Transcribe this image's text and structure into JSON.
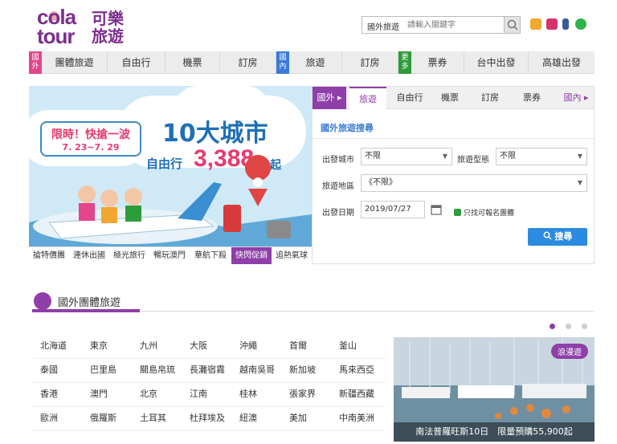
{
  "logo": {
    "en1": "cola",
    "en2": "tour",
    "cn1": "可樂",
    "cn2": "旅遊"
  },
  "search": {
    "category": "國外旅遊",
    "placeholder": "請輸入關鍵字"
  },
  "nav": {
    "groups": [
      {
        "tag": "國外"
      },
      {
        "tag": "國內"
      },
      {
        "tag": "更多"
      }
    ],
    "items": [
      "團體旅遊",
      "自由行",
      "機票",
      "訂房",
      "旅遊",
      "訂房",
      "票券",
      "台中出發",
      "高雄出發"
    ]
  },
  "banner": {
    "promo1": "限時！快搶一波",
    "promo2": "7. 23~7. 29",
    "headline": "10大城市",
    "sub1": "自由行",
    "price": "3,388",
    "sub2": "起",
    "tabs": [
      "搶特價團",
      "連休出國",
      "極光旅行",
      "暢玩澳門",
      "華航下殺",
      "快閃促銷",
      "追熱氣球"
    ]
  },
  "panel": {
    "tabs": [
      "國外",
      "旅遊",
      "自由行",
      "機票",
      "訂房",
      "票券",
      "國內"
    ],
    "title": "國外旅遊搜尋",
    "depart_label": "出發城市",
    "depart_value": "不限",
    "type_label": "旅遊型態",
    "type_value": "不限",
    "region_label": "旅遊地區",
    "region_value": "《不限》",
    "date_label": "出發日期",
    "date_value": "2019/07/27",
    "checkbox_label": "只找可報名團體",
    "search_button": "搜尋"
  },
  "section": {
    "title": "國外團體旅遊"
  },
  "destinations": [
    [
      "北海道",
      "東京",
      "九州",
      "大阪",
      "沖繩",
      "首爾",
      "釜山"
    ],
    [
      "泰國",
      "巴里島",
      "關島帛琉",
      "長灘宿霧",
      "越南吳哥",
      "新加坡",
      "馬來西亞"
    ],
    [
      "香港",
      "澳門",
      "北京",
      "江南",
      "桂林",
      "張家界",
      "新疆西藏"
    ],
    [
      "歐洲",
      "俄羅斯",
      "土耳其",
      "杜拜埃及",
      "紐澳",
      "美加",
      "中南美洲"
    ]
  ],
  "feature": {
    "badge": "浪漫遊",
    "caption": "南法普羅旺斯10日　限量預購55,900起"
  },
  "colors": {
    "brand": "#7b2f8e",
    "link": "#3a7bd5",
    "button": "#2b8be0",
    "promo": "#e63b6f"
  }
}
